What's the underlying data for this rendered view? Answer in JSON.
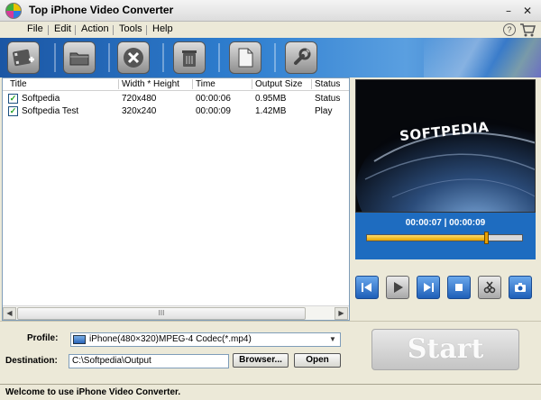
{
  "window": {
    "title": "Top iPhone Video Converter",
    "minimize": "–",
    "close": "✕"
  },
  "menu": {
    "items": [
      "File",
      "Edit",
      "Action",
      "Tools",
      "Help"
    ]
  },
  "toolbar": {
    "buttons": [
      "add-video",
      "load-folder",
      "remove",
      "clear-list",
      "properties",
      "settings"
    ]
  },
  "file_list": {
    "columns": [
      "Title",
      "Width * Height",
      "Time",
      "Output Size",
      "Status"
    ],
    "rows": [
      {
        "checked": true,
        "title": "Softpedia",
        "size": "720x480",
        "time": "00:00:06",
        "output_size": "0.95MB",
        "status": "Status"
      },
      {
        "checked": true,
        "title": "Softpedia Test",
        "size": "320x240",
        "time": "00:00:09",
        "output_size": "1.42MB",
        "status": "Play"
      }
    ],
    "scroll_grip": "III"
  },
  "preview": {
    "video_text": "SOFTPEDIA",
    "time_display": "00:00:07 | 00:00:09",
    "progress_fraction": 0.77,
    "buttons": [
      "previous",
      "play",
      "next",
      "stop",
      "snapshot-mode",
      "capture"
    ]
  },
  "bottom": {
    "profile_label": "Profile:",
    "profile_value": "iPhone(480×320)MPEG-4 Codec(*.mp4)",
    "destination_label": "Destination:",
    "destination_value": "C:\\Softpedia\\Output",
    "browse_label": "Browser...",
    "open_label": "Open",
    "start_label": "Start"
  },
  "status": {
    "message": "Welcome to use iPhone Video Converter."
  },
  "colors": {
    "toolbar_blue": "#2f7fd0",
    "accent_orange": "#e6a600",
    "panel_blue": "#1e6cc0"
  }
}
